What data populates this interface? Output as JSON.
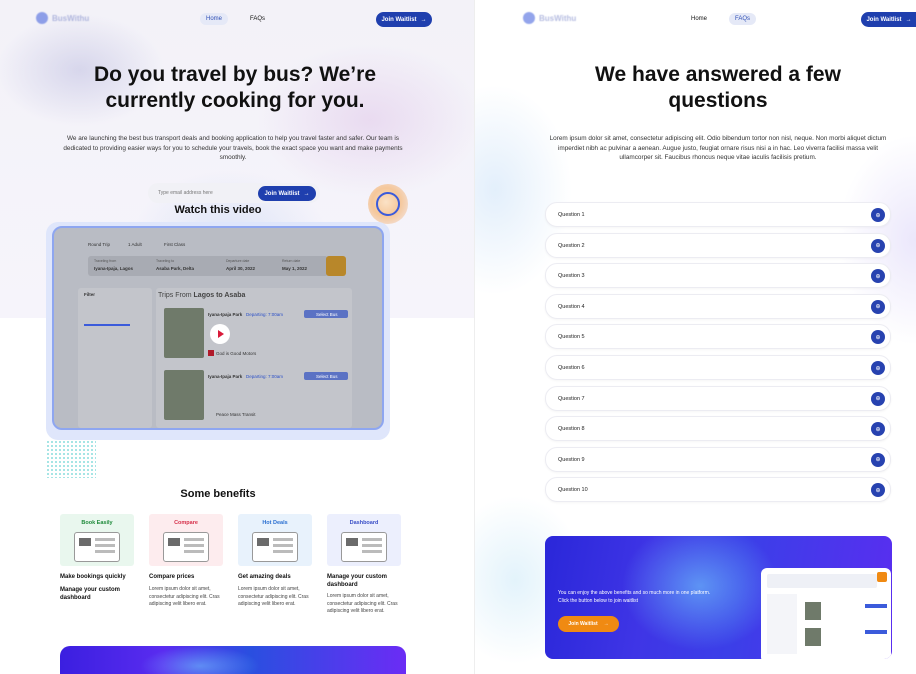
{
  "left": {
    "nav": {
      "logo_text": "BusWithu",
      "links": [
        "Home",
        "FAQs"
      ],
      "active_link": "Home",
      "cta": "Join Waitlist",
      "cta_arrow": "→"
    },
    "hero": {
      "title_line1": "Do you travel by bus? We’re",
      "title_line2": "currently cooking for you.",
      "paragraph": "We are launching the best bus transport deals and booking application to help you travel faster and safer. Our team is dedicated to providing easier ways for you to schedule your travels, book the exact space you want and make payments smoothly.",
      "email_placeholder": "Type email address here",
      "join_button": "Join Waitlist"
    },
    "video": {
      "heading": "Watch this video",
      "screenshot": {
        "tabs": [
          "Round Trip",
          "1 Adult",
          "First Class"
        ],
        "from_label": "Traveling from",
        "from_value": "Iyana-Ipaja, Lagos",
        "to_label": "Traveling to",
        "to_value": "Asaba Park, Delta",
        "depart_label": "Departure date",
        "depart_value": "April 30, 2022",
        "return_label": "Return date",
        "return_value": "May 1, 2022",
        "filter_label": "Filter",
        "trips_prefix": "Trips From ",
        "trips_route": "Lagos to Asaba",
        "result1_title": "Iyana-Ipaja Park",
        "result1_sub": "Departing: 7:00am",
        "result1_btn": "Select Bus",
        "result1_company": "God is Good Motors",
        "result2_title": "Iyana-Ipaja Park",
        "result2_sub": "Departing: 7:00am",
        "result2_btn": "Select Bus",
        "result2_company": "Peace Mass Transit"
      }
    },
    "benefits": {
      "title": "Some benefits",
      "cards": [
        {
          "tag": "Book Easily",
          "tag_color": "#1e8a3a",
          "bg": "#e9f7ee",
          "title": "Make bookings quickly",
          "desc": ""
        },
        {
          "tag": "Compare",
          "tag_color": "#d6304a",
          "bg": "#fdecee",
          "title": "Compare prices",
          "desc": "Lorem ipsum dolor sit amet, consectetur adipiscing elit. Cras adipiscing velit libero erat."
        },
        {
          "tag": "Hot Deals",
          "tag_color": "#2a6fd1",
          "bg": "#e8f2fc",
          "title": "Get amazing deals",
          "desc": "Lorem ipsum dolor sit amet, consectetur adipiscing elit. Cras adipiscing velit libero erat."
        },
        {
          "tag": "Dashboard",
          "tag_color": "#3b4fc7",
          "bg": "#eceffd",
          "title": "Manage your custom dashboard",
          "desc": "Lorem ipsum dolor sit amet, consectetur adipiscing elit. Cras adipiscing velit libero erat."
        }
      ],
      "extra_title": "Manage your custom dashboard"
    }
  },
  "right": {
    "nav": {
      "logo_text": "BusWithu",
      "links": [
        "Home",
        "FAQs"
      ],
      "active_link": "FAQs",
      "cta": "Join Waitlist",
      "cta_arrow": "→"
    },
    "faq": {
      "title_line1": "We have answered a few",
      "title_line2": "questions",
      "paragraph": "Lorem ipsum dolor sit amet, consectetur adipiscing elit. Odio bibendum tortor non nisl, neque. Non morbi aliquet dictum imperdiet nibh ac pulvinar a aenean. Augue justo, feugiat ornare risus nisi a in hac. Leo viverra facilisi massa velit ullamcorper sit. Faucibus rhoncus neque vitae iaculis facilisis pretium.",
      "questions": [
        "Question 1",
        "Question 2",
        "Question 3",
        "Question 4",
        "Question 5",
        "Question 6",
        "Question 7",
        "Question 8",
        "Question 9",
        "Question 10"
      ],
      "expand_icon": "⊕"
    },
    "cta": {
      "text": "You can enjoy the above benefits and so much more in one platform. Click the button below to join waitlist",
      "button": "Join Waitlist",
      "button_arrow": "→"
    }
  },
  "colors": {
    "primary": "#1f3fae",
    "accent_orange": "#f08a12",
    "cta_gradient_start": "#2a27d9",
    "cta_gradient_end": "#5a2df0"
  }
}
